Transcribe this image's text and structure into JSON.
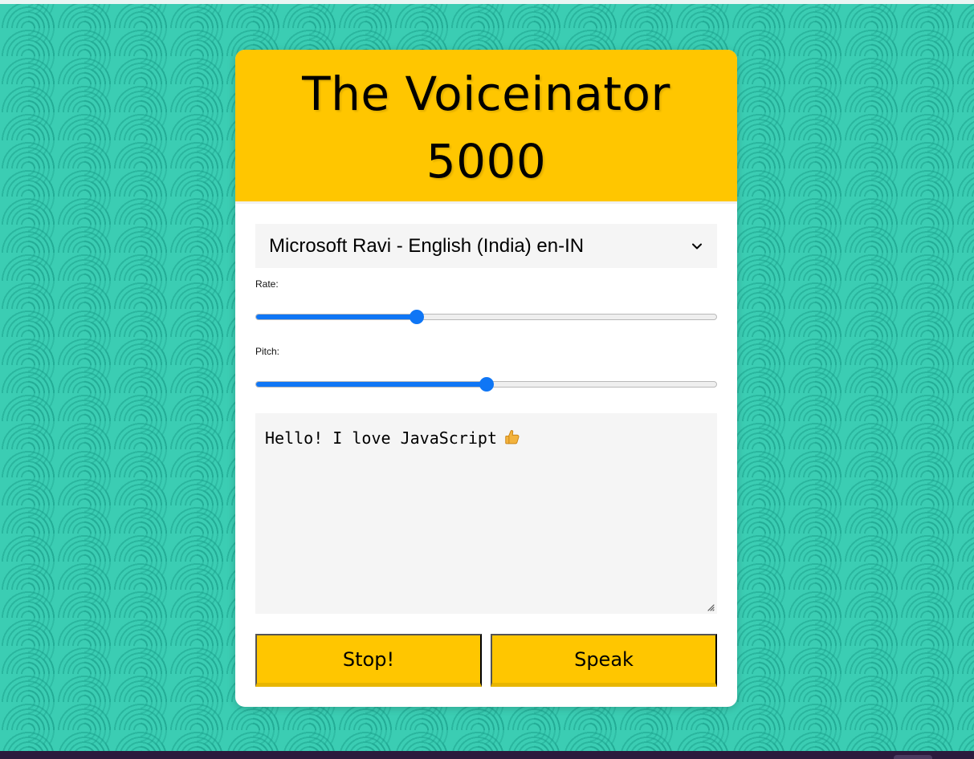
{
  "app": {
    "title": "The Voiceinator 5000"
  },
  "voice_select": {
    "selected": "Microsoft Ravi - English (India) en-IN",
    "icon": "chevron-down-icon"
  },
  "controls": {
    "rate": {
      "label": "Rate:",
      "level": 0.35
    },
    "pitch": {
      "label": "Pitch:",
      "level": 0.5
    }
  },
  "text": {
    "value": "Hello! I love JavaScript",
    "emoji_icon": "thumbs-up-icon"
  },
  "buttons": {
    "stop": "Stop!",
    "speak": "Speak"
  },
  "colors": {
    "accent": "#ffc600",
    "background": "#3bcdb3",
    "slider": "#0f76f5"
  }
}
